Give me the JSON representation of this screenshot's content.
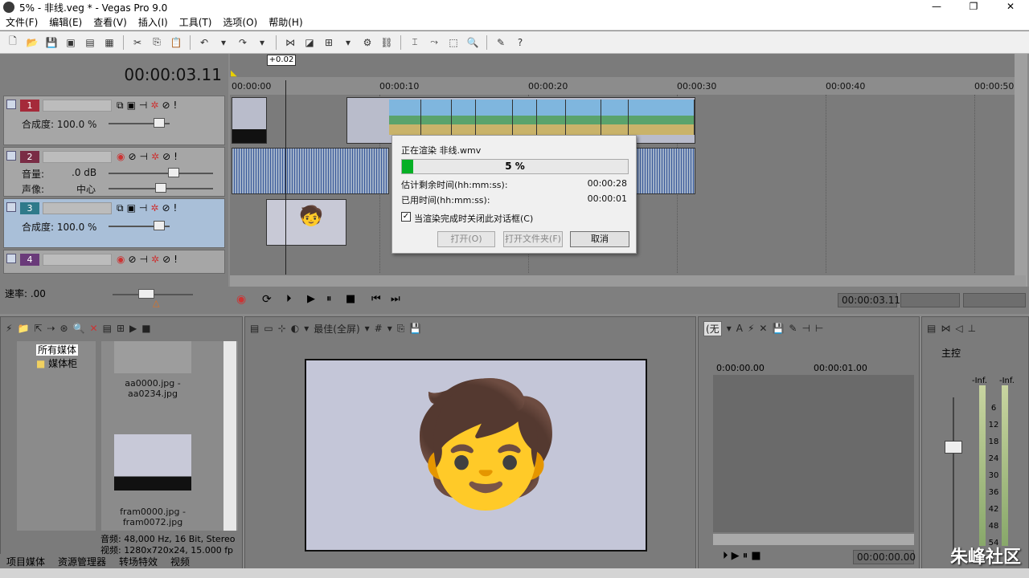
{
  "window": {
    "title": "5% - 非线.veg * - Vegas Pro 9.0",
    "controls": [
      "—",
      "❐",
      "✕"
    ]
  },
  "menu": [
    "文件(F)",
    "编辑(E)",
    "查看(V)",
    "插入(I)",
    "工具(T)",
    "选项(O)",
    "帮助(H)"
  ],
  "timecode": "00:00:03.11",
  "offset_badge": "+0.02",
  "ruler": [
    "00:00:00",
    "00:00:10",
    "00:00:20",
    "00:00:30",
    "00:00:40",
    "00:00:50"
  ],
  "tracks": [
    {
      "num": "1",
      "color": "#a52a3a",
      "kind": "video",
      "label1": "合成度: 100.0 %"
    },
    {
      "num": "2",
      "color": "#7a2c45",
      "kind": "audio",
      "vol_label": "音量:",
      "vol_value": ".0 dB",
      "pan_label": "声像:",
      "pan_value": "中心"
    },
    {
      "num": "3",
      "color": "#2f7a8a",
      "kind": "video",
      "label1": "合成度: 100.0 %"
    },
    {
      "num": "4",
      "color": "#6a3a7a",
      "kind": "audio"
    }
  ],
  "speed_label": "速率: .00",
  "render_dialog": {
    "title": "正在渲染 非线.wmv",
    "progress_percent": 5,
    "progress_text": "5 %",
    "remaining_label": "估计剩余时间(hh:mm:ss):",
    "remaining_value": "00:00:28",
    "elapsed_label": "已用时间(hh:mm:ss):",
    "elapsed_value": "00:00:01",
    "checkbox_label": "当渲染完成时关闭此对话框(C)",
    "checkbox_checked": true,
    "open_button": "打开(O)",
    "open_folder_button": "打开文件夹(F)",
    "cancel_button": "取消"
  },
  "transport_timecode": "00:00:03.11",
  "media": {
    "tree": [
      "所有媒体",
      "媒体柜"
    ],
    "items": [
      {
        "caption": "aa0000.jpg - aa0234.jpg"
      },
      {
        "caption": "fram0000.jpg - fram0072.jpg"
      }
    ],
    "info_audio": "音频: 48,000 Hz, 16 Bit, Stereo",
    "info_video": "视频: 1280x720x24, 15.000 fp"
  },
  "tabs": [
    "项目媒体",
    "资源管理器",
    "转场特效",
    "视频"
  ],
  "preview": {
    "quality": "最佳(全屏)"
  },
  "trimmer": {
    "select": "(无",
    "times": [
      "0:00:00.00",
      "00:00:01.00"
    ],
    "timecode": "00:00:00.00"
  },
  "master": {
    "label": "主控",
    "inf": [
      "-Inf.",
      "-Inf."
    ],
    "scale": [
      "6",
      "12",
      "18",
      "24",
      "30",
      "36",
      "42",
      "48",
      "54"
    ]
  },
  "watermark": "朱峰社区"
}
